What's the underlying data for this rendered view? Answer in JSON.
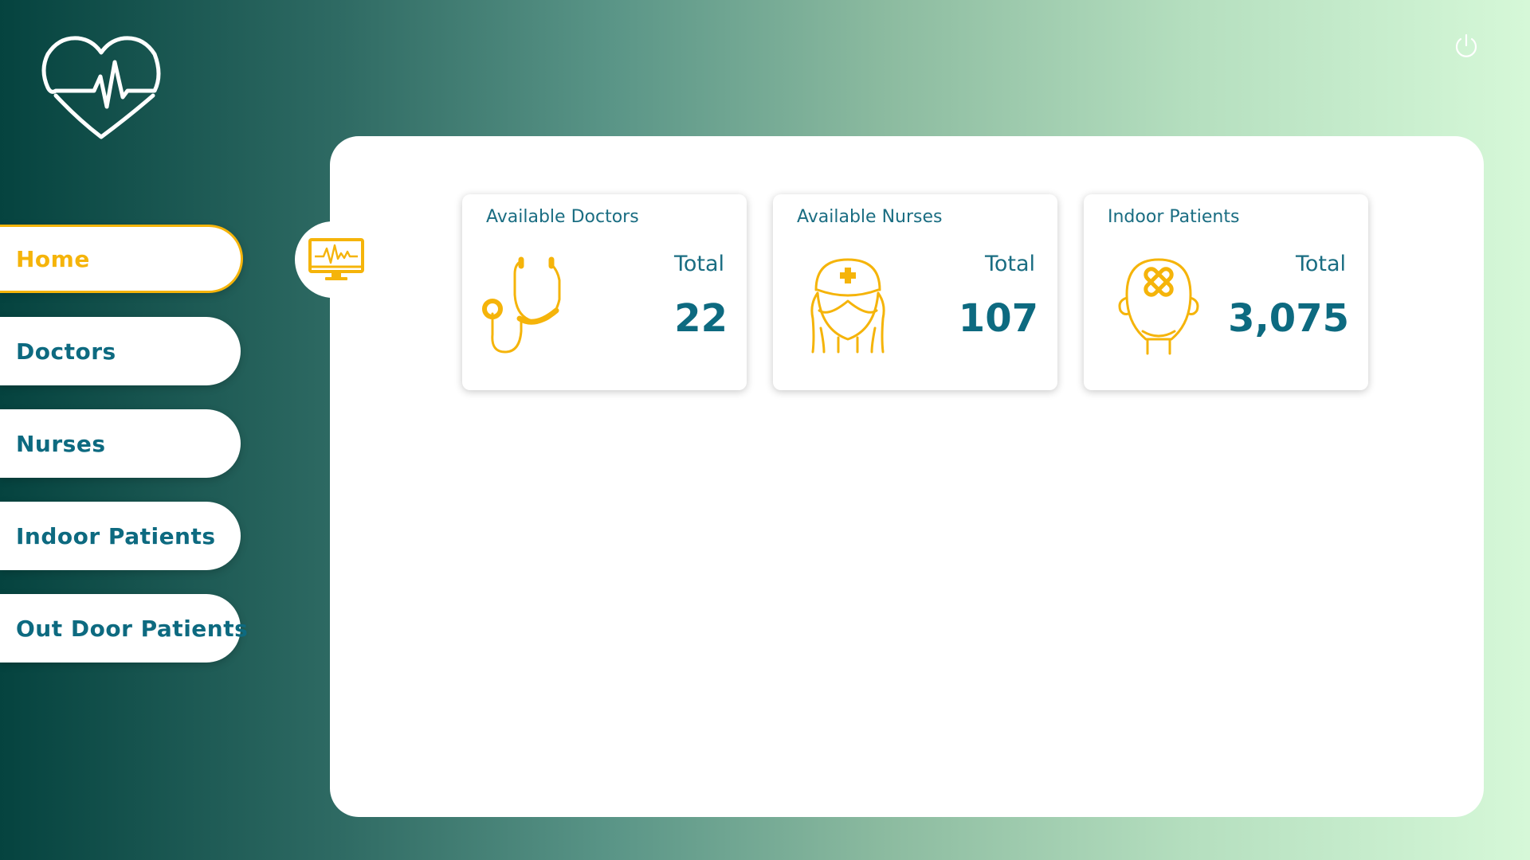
{
  "colors": {
    "accent": "#f5b40a",
    "primary_text": "#0d6a80",
    "background_dark": "#05433f",
    "background_light": "#d6f8d8"
  },
  "header": {
    "logo_icon": "heartbeat-heart-icon",
    "power_icon": "power-icon"
  },
  "sidebar": {
    "items": [
      {
        "label": "Home",
        "active": true
      },
      {
        "label": "Doctors",
        "active": false
      },
      {
        "label": "Nurses",
        "active": false
      },
      {
        "label": "Indoor Patients",
        "active": false
      },
      {
        "label": "Out Door Patients",
        "active": false
      }
    ]
  },
  "main": {
    "tab_icon": "monitor-heartbeat-icon",
    "cards": [
      {
        "title": "Available Doctors",
        "total_label": "Total",
        "value": "22",
        "icon": "stethoscope-icon"
      },
      {
        "title": "Available Nurses",
        "total_label": "Total",
        "value": "107",
        "icon": "nurse-icon"
      },
      {
        "title": "Indoor Patients",
        "total_label": "Total",
        "value": "3,075",
        "icon": "injured-patient-icon"
      }
    ]
  }
}
